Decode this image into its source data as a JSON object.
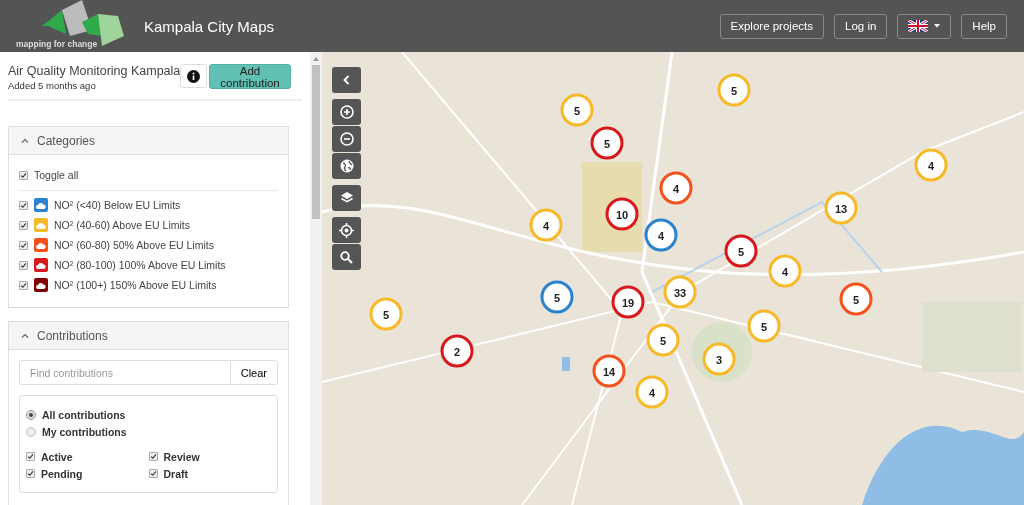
{
  "header": {
    "brand": "mapping for change",
    "title": "Kampala City Maps",
    "buttons": [
      {
        "label": "Explore projects",
        "kind": "text"
      },
      {
        "label": "Log in",
        "kind": "text"
      },
      {
        "kind": "language"
      },
      {
        "label": "Help",
        "kind": "text"
      }
    ]
  },
  "project": {
    "title": "Air Quality Monitoring Kampala",
    "added": "Added 5 months ago",
    "action": "Add contribution"
  },
  "categories": {
    "title": "Categories",
    "expanded": true,
    "toggle_all": {
      "label": "Toggle all",
      "checked": true
    },
    "items": [
      {
        "label": "NO² (<40) Below EU Limits",
        "checked": true,
        "color": "#2b83cf"
      },
      {
        "label": "NO² (40-60) Above EU Limits",
        "checked": true,
        "color": "#f7b928"
      },
      {
        "label": "NO² (60-80) 50% Above EU Limits",
        "checked": true,
        "color": "#f5511e"
      },
      {
        "label": "NO² (80-100) 100% Above EU Limits",
        "checked": true,
        "color": "#d7191c"
      },
      {
        "label": "NO² (100+) 150% Above EU Limits",
        "checked": true,
        "color": "#7f0000"
      }
    ]
  },
  "contributions": {
    "title": "Contributions",
    "expanded": true,
    "search": {
      "placeholder": "Find contributions",
      "button": "Clear"
    },
    "filters": [
      {
        "label": "All contributions",
        "selected": true
      },
      {
        "label": "My contributions",
        "selected": false
      }
    ],
    "statuses": [
      {
        "label": "Active",
        "checked": true
      },
      {
        "label": "Review",
        "checked": true
      },
      {
        "label": "Pending",
        "checked": true
      },
      {
        "label": "Draft",
        "checked": true
      }
    ]
  },
  "map": {
    "kind": "picture",
    "clusters": [
      {
        "count": "5",
        "color": "#f7b928"
      },
      {
        "count": "5",
        "color": "#f7b928"
      },
      {
        "count": "5",
        "color": "#d7191c"
      },
      {
        "count": "4",
        "color": "#f7b928"
      },
      {
        "count": "4",
        "color": "#f5511e"
      },
      {
        "count": "13",
        "color": "#f7b928"
      },
      {
        "count": "10",
        "color": "#d7191c"
      },
      {
        "count": "4",
        "color": "#f7b928"
      },
      {
        "count": "4",
        "color": "#2b83cf"
      },
      {
        "count": "5",
        "color": "#d7191c"
      },
      {
        "count": "4",
        "color": "#f7b928"
      },
      {
        "count": "5",
        "color": "#2b83cf"
      },
      {
        "count": "19",
        "color": "#d7191c"
      },
      {
        "count": "33",
        "color": "#f7b928"
      },
      {
        "count": "5",
        "color": "#f5511e"
      },
      {
        "count": "5",
        "color": "#f7b928"
      },
      {
        "count": "5",
        "color": "#f7b928"
      },
      {
        "count": "5",
        "color": "#f7b928"
      },
      {
        "count": "2",
        "color": "#d7191c"
      },
      {
        "count": "3",
        "color": "#f7b928"
      },
      {
        "count": "14",
        "color": "#f5511e"
      },
      {
        "count": "4",
        "color": "#f7b928"
      }
    ]
  }
}
